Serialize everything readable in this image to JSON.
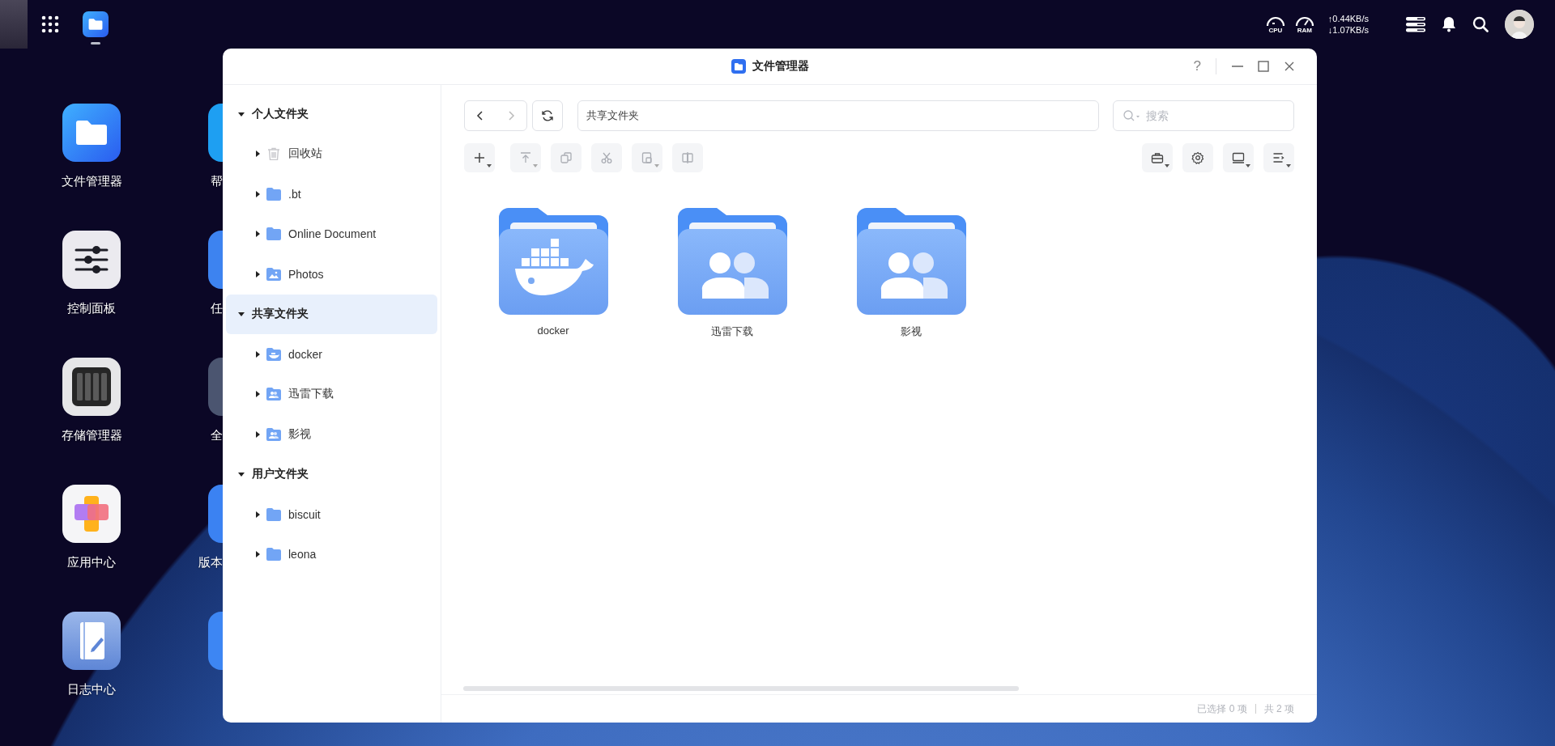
{
  "taskbar": {
    "apps": [
      {
        "kind": "files",
        "running": true
      }
    ]
  },
  "status_area": {
    "cpu_label": "CPU",
    "ram_label": "RAM",
    "upload": "↑0.44KB/s",
    "download": "↓1.07KB/s"
  },
  "desktop_column_1": [
    {
      "label": "文件管理器",
      "kind": "files"
    },
    {
      "label": "控制面板",
      "kind": "control"
    },
    {
      "label": "存储管理器",
      "kind": "storage"
    },
    {
      "label": "应用中心",
      "kind": "appcenter"
    },
    {
      "label": "日志中心",
      "kind": "log"
    }
  ],
  "desktop_column_2": [
    {
      "label": "帮",
      "kind": "help"
    },
    {
      "label": "任",
      "kind": "tasks"
    },
    {
      "label": "全",
      "kind": "all"
    },
    {
      "label": "版本",
      "kind": "version"
    },
    {
      "kind": "tool"
    }
  ],
  "window": {
    "title": "文件管理器",
    "help": "?"
  },
  "sidebar": {
    "sections": [
      {
        "label": "个人文件夹",
        "expanded": true,
        "selected": false,
        "children": [
          {
            "label": "回收站",
            "kind": "trash",
            "expanded": false
          },
          {
            "label": ".bt",
            "kind": "folder",
            "expanded": false
          },
          {
            "label": "Online Document",
            "kind": "folder",
            "expanded": false
          },
          {
            "label": "Photos",
            "kind": "photos",
            "expanded": false
          }
        ]
      },
      {
        "label": "共享文件夹",
        "expanded": true,
        "selected": true,
        "children": [
          {
            "label": "docker",
            "kind": "docker",
            "expanded": false
          },
          {
            "label": "迅雷下载",
            "kind": "shared",
            "expanded": false
          },
          {
            "label": "影视",
            "kind": "shared",
            "expanded": false
          }
        ]
      },
      {
        "label": "用户文件夹",
        "expanded": true,
        "selected": false,
        "children": [
          {
            "label": "biscuit",
            "kind": "folder",
            "expanded": false
          },
          {
            "label": "leona",
            "kind": "folder",
            "expanded": false
          }
        ]
      }
    ]
  },
  "path_field": {
    "value": "共享文件夹"
  },
  "search": {
    "placeholder": "搜索"
  },
  "toolbar_left": [
    {
      "kind": "new",
      "disabled": false,
      "dropdown": true
    },
    {
      "kind": "upload",
      "disabled": true,
      "dropdown": true
    },
    {
      "kind": "copy",
      "disabled": true,
      "dropdown": false
    },
    {
      "kind": "cut",
      "disabled": true,
      "dropdown": false
    },
    {
      "kind": "paste",
      "disabled": true,
      "dropdown": true
    },
    {
      "kind": "move",
      "disabled": true,
      "dropdown": false
    }
  ],
  "toolbar_right": [
    {
      "kind": "tools",
      "disabled": false,
      "dropdown": true
    },
    {
      "kind": "settings",
      "disabled": false,
      "dropdown": false
    },
    {
      "kind": "view",
      "disabled": false,
      "dropdown": true
    },
    {
      "kind": "sort",
      "disabled": false,
      "dropdown": true
    }
  ],
  "folders": [
    {
      "name": "docker",
      "kind": "docker"
    },
    {
      "name": "迅雷下载",
      "kind": "shared"
    },
    {
      "name": "影视",
      "kind": "shared"
    }
  ],
  "status_bar": {
    "selected": "已选择 0 项",
    "total": "共 2 项"
  }
}
